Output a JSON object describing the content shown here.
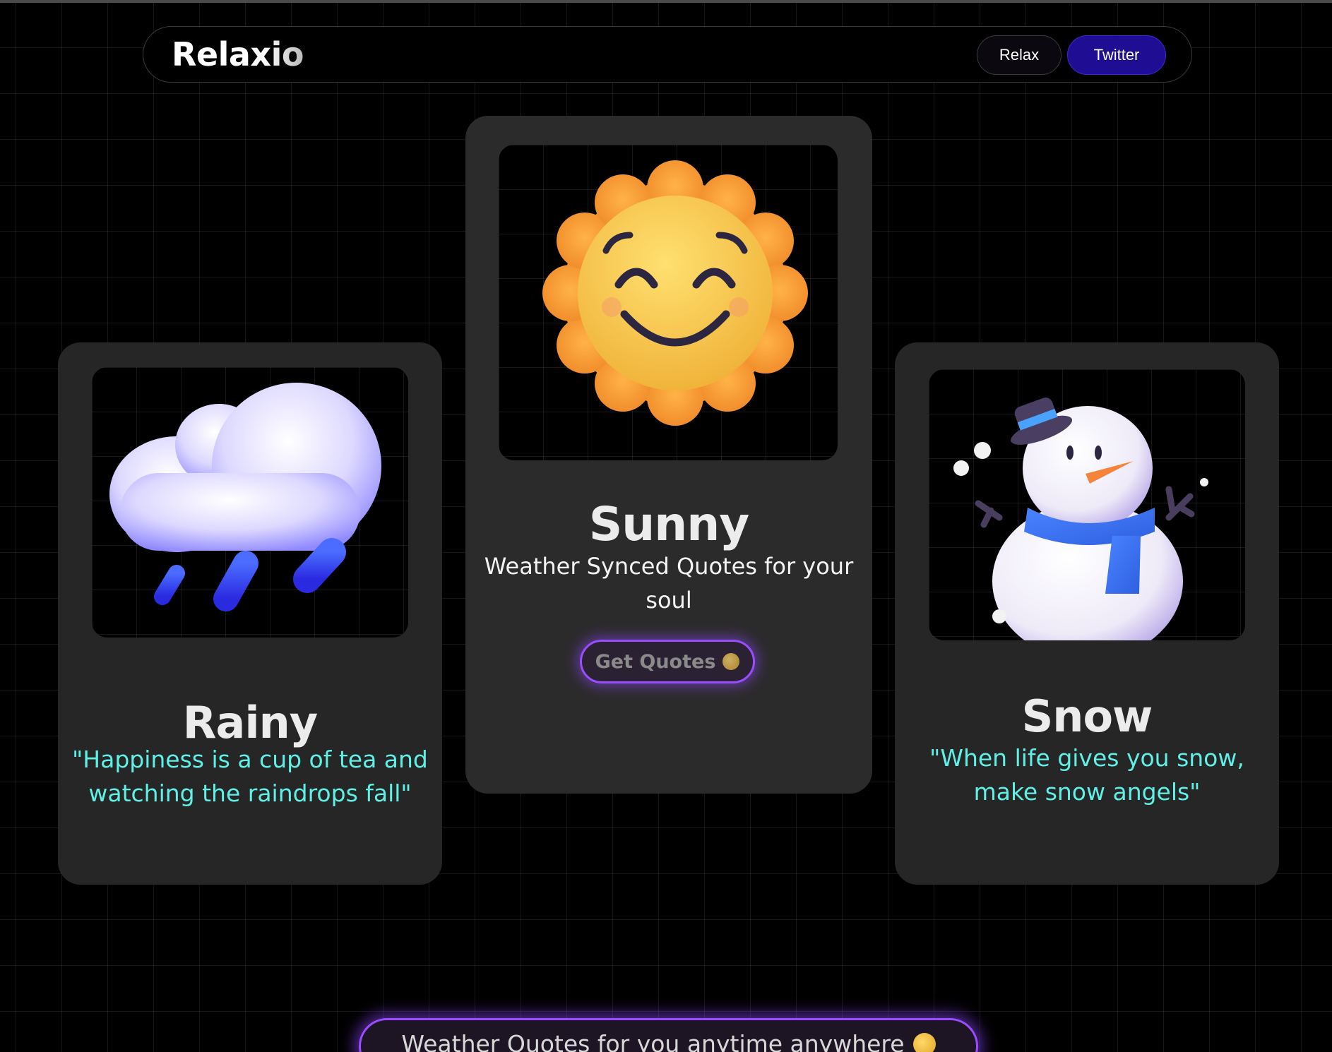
{
  "header": {
    "brand": "Relaxio",
    "nav": [
      {
        "label": "Relax"
      },
      {
        "label": "Twitter"
      }
    ]
  },
  "cards": {
    "rainy": {
      "title": "Rainy",
      "quote": "\"Happiness is a cup of tea and watching the raindrops fall\"",
      "image_icon": "rain-cloud-icon"
    },
    "sunny": {
      "title": "Sunny",
      "subtitle": "Weather Synced Quotes for your soul",
      "button_label": "Get Quotes",
      "button_emoji": "smiling-face-with-halo-icon",
      "image_icon": "smiling-sun-icon"
    },
    "snow": {
      "title": "Snow",
      "quote": "\"When life gives you snow, make snow angels\"",
      "image_icon": "snowman-icon"
    }
  },
  "footer": {
    "banner_text": "Weather Quotes for you anytime anywhere",
    "banner_emoji": "smiling-face-with-halo-icon"
  },
  "colors": {
    "background": "#000000",
    "card": "#272627",
    "accent_purple": "#9a4dff",
    "quote_cyan": "#5ff0e6",
    "twitter_button": "#1f0e93"
  }
}
